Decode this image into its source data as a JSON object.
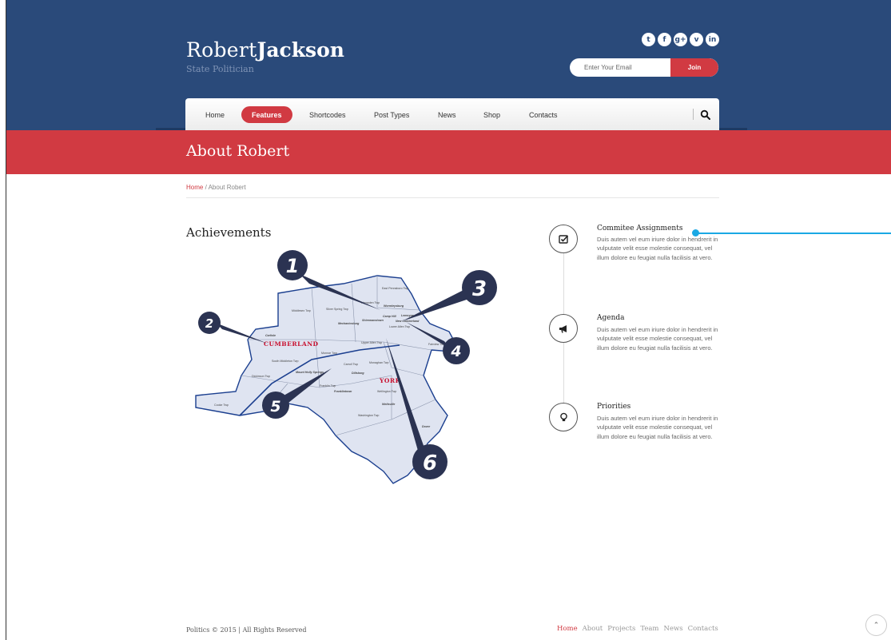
{
  "header": {
    "logo_first": "Robert",
    "logo_last": "Jackson",
    "subtitle": "State Politician",
    "social_icons": [
      {
        "name": "twitter-icon",
        "glyph": "t"
      },
      {
        "name": "facebook-icon",
        "glyph": "f"
      },
      {
        "name": "google-plus-icon",
        "glyph": "g+"
      },
      {
        "name": "vimeo-icon",
        "glyph": "v"
      },
      {
        "name": "linkedin-icon",
        "glyph": "in"
      }
    ],
    "email_placeholder": "Enter Your Email",
    "join_label": "Join"
  },
  "nav": {
    "items": [
      "Home",
      "Features",
      "Shortcodes",
      "Post Types",
      "News",
      "Shop",
      "Contacts"
    ],
    "active": "Features"
  },
  "banner": {
    "title": "About Robert"
  },
  "breadcrumb": {
    "home": "Home",
    "separator": "/",
    "current": "About Robert"
  },
  "main": {
    "section_title": "Achievements",
    "map": {
      "markers": [
        "1",
        "2",
        "3",
        "4",
        "5",
        "6"
      ],
      "county_labels": [
        "CUMBERLAND",
        "YORK"
      ],
      "town_labels": [
        "Middlesex Twp",
        "Silver Spring Twp",
        "Hampden Twp",
        "East Pennsboro Twp",
        "Wormleysburg",
        "Mechanicsburg",
        "Shiremanstown",
        "Camp Hill",
        "Lemoyne",
        "New Cumberland",
        "Lower Allen Twp",
        "Upper Allen Twp",
        "Fairview Twp",
        "Carlisle",
        "Monroe Twp",
        "Monaghan Twp",
        "South Middleton Twp",
        "Carroll Twp",
        "Dillsburg",
        "Mount Holly Springs",
        "Wellington Twp",
        "Dickinson Twp",
        "Franklin Twp",
        "Franklintown",
        "Cooke Twp",
        "Wellsville",
        "Washington Twp",
        "Dover"
      ]
    },
    "timeline": [
      {
        "icon": "checklist-icon",
        "title": "Commitee Assignments",
        "text": "Duis autem vel eum iriure dolor in hendrerit in vulputate velit esse molestie consequat, vel illum dolore eu feugiat nulla facilisis at vero."
      },
      {
        "icon": "megaphone-icon",
        "title": "Agenda",
        "text": "Duis autem vel eum iriure dolor in hendrerit in vulputate velit esse molestie consequat, vel illum dolore eu feugiat nulla facilisis at vero."
      },
      {
        "icon": "lightbulb-icon",
        "title": "Priorities",
        "text": "Duis autem vel eum iriure dolor in hendrerit in vulputate velit esse molestie consequat, vel illum dolore eu feugiat nulla facilisis at vero."
      }
    ]
  },
  "footer": {
    "copyright": "Politics © 2015 | All Rights Reserved",
    "links": [
      "Home",
      "About",
      "Projects",
      "Team",
      "News",
      "Contacts"
    ],
    "active_link": "Home",
    "to_top_glyph": "⌃"
  },
  "colors": {
    "header_blue": "#2a4a7a",
    "accent_red": "#d13a42",
    "callout_blue": "#1aa8e4",
    "marker_navy": "#2b3352"
  }
}
